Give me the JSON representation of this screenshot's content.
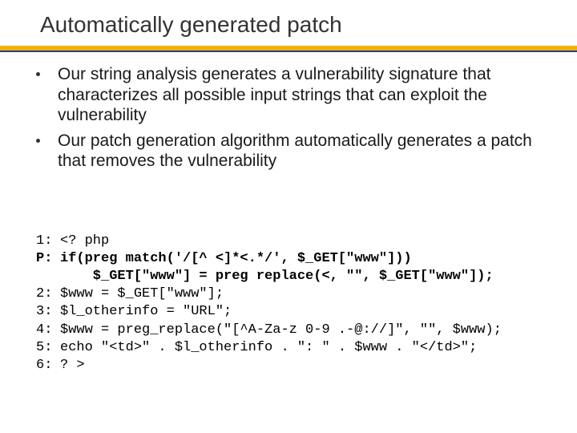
{
  "title": "Automatically generated patch",
  "bullets": [
    "Our string analysis generates a vulnerability signature that characterizes all possible input strings that can exploit the vulnerability",
    "Our patch generation algorithm automatically generates a patch that removes the vulnerability"
  ],
  "code": {
    "l1_label": "1:",
    "l1_text": "<? php",
    "lp_label": "P:",
    "lp_text1": "if(preg match('/[^ <]*<.*/', $_GET[\"www\"]))",
    "lp_text2": "    $_GET[\"www\"] = preg replace(<, \"\", $_GET[\"www\"]);",
    "l2_label": "2:",
    "l2_text": "$www = $_GET[\"www\"];",
    "l3_label": "3:",
    "l3_text": "$l_otherinfo = \"URL\";",
    "l4_label": "4:",
    "l4_text": "$www = preg_replace(\"[^A-Za-z 0-9 .-@://]\", \"\", $www);",
    "l5_label": "5:",
    "l5_text": "echo \"<td>\" . $l_otherinfo . \": \" . $www . \"</td>\";",
    "l6_label": "6:",
    "l6_text": "? >"
  }
}
